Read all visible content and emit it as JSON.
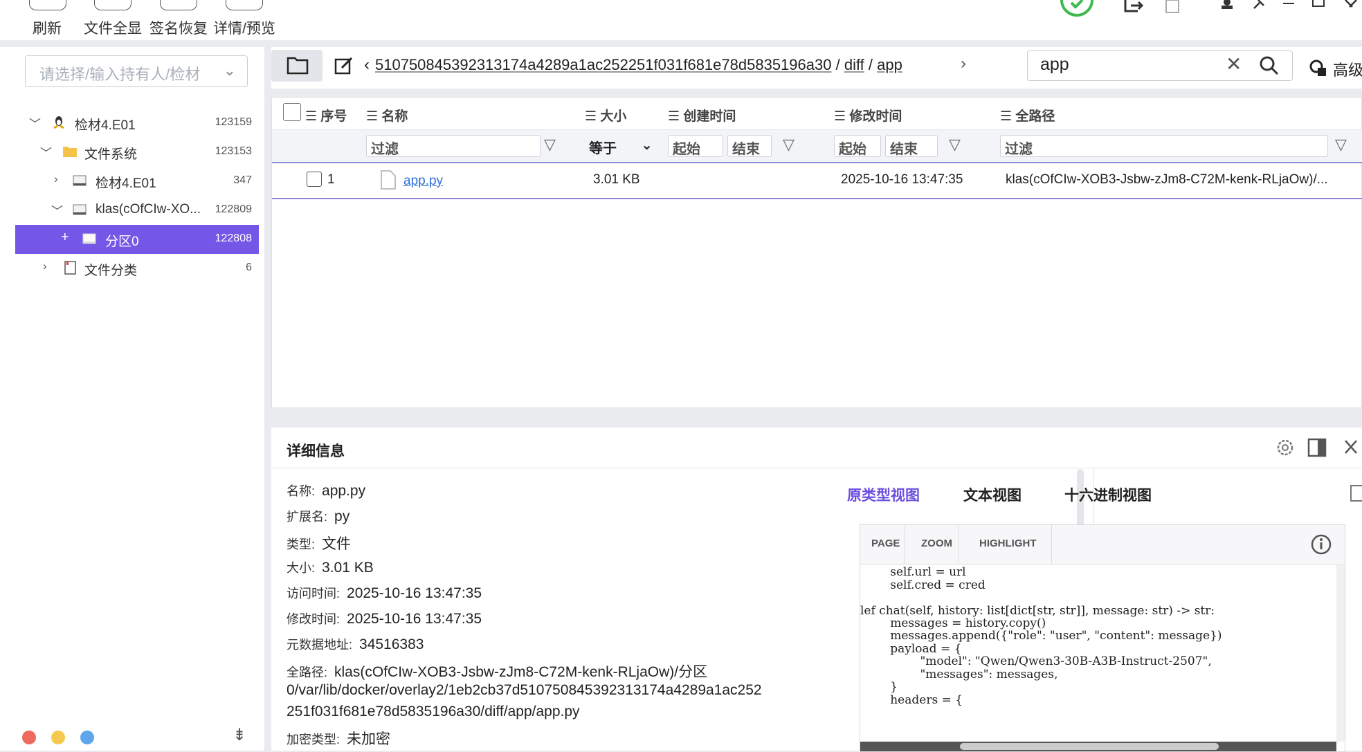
{
  "toolbar": {
    "refresh_label": "刷新",
    "show_all_label": "文件全显",
    "sig_recover_label": "签名恢复",
    "detail_preview_label": "详情/预览"
  },
  "sidebar": {
    "holder_placeholder": "请选择/输入持有人/检材",
    "tree": [
      {
        "label": "检材4.E01",
        "count": "123159"
      },
      {
        "label": "文件系统",
        "count": "123153"
      },
      {
        "label": "检材4.E01",
        "count": "347"
      },
      {
        "label": "klas(cOfCIw-XO...",
        "count": "122809"
      },
      {
        "label": "分区0",
        "count": "122808"
      },
      {
        "label": "文件分类",
        "count": "6"
      }
    ]
  },
  "breadcrumb": {
    "segments": [
      "510750845392313174a4289a1ac252251f031f681e78d5835196a30",
      "diff",
      "app"
    ],
    "separator": "/"
  },
  "search": {
    "value": "app",
    "advanced_label": "高级"
  },
  "table": {
    "columns": [
      "序号",
      "名称",
      "大小",
      "创建时间",
      "修改时间",
      "全路径"
    ],
    "filters": {
      "name_placeholder": "过滤",
      "size_op": "等于",
      "created_start": "起始",
      "created_end": "结束",
      "modified_start": "起始",
      "modified_end": "结束",
      "path_placeholder": "过滤"
    },
    "rows": [
      {
        "index": "1",
        "name": "app.py",
        "size": "3.01 KB",
        "created": "",
        "modified": "2025-10-16 13:47:35",
        "path": "klas(cOfCIw-XOB3-Jsbw-zJm8-C72M-kenk-RLjaOw)/..."
      }
    ]
  },
  "details": {
    "title": "详细信息",
    "fields": [
      {
        "key": "名称:",
        "value": "app.py"
      },
      {
        "key": "扩展名:",
        "value": "py"
      },
      {
        "key": "类型:",
        "value": "文件"
      },
      {
        "key": "大小:",
        "value": "3.01 KB"
      },
      {
        "key": "访问时间:",
        "value": "2025-10-16 13:47:35"
      },
      {
        "key": "修改时间:",
        "value": "2025-10-16 13:47:35"
      },
      {
        "key": "元数据地址:",
        "value": "34516383"
      }
    ],
    "fullpath_key": "全路径:",
    "fullpath_lines": [
      "klas(cOfCIw-XOB3-Jsbw-zJm8-C72M-kenk-RLjaOw)/分区",
      "0/var/lib/docker/overlay2/1eb2cb37d510750845392313174a4289a1ac252",
      "251f031f681e78d5835196a30/diff/app/app.py"
    ],
    "encrypt_key": "加密类型:",
    "encrypt_value": "未加密",
    "tabs": [
      "原类型视图",
      "文本视图",
      "十六进制视图"
    ],
    "viewer_buttons": [
      "PAGE",
      "ZOOM",
      "HIGHLIGHT"
    ],
    "code_lines": [
      "        self.url = url",
      "        self.cred = cred",
      "",
      "lef chat(self, history: list[dict[str, str]], message: str) -> str:",
      "        messages = history.copy()",
      "        messages.append({\"role\": \"user\", \"content\": message})",
      "        payload = {",
      "                \"model\": \"Qwen/Qwen3-30B-A3B-Instruct-2507\",",
      "                \"messages\": messages,",
      "        }",
      "        headers = {"
    ]
  },
  "colors": {
    "accent": "#7557e8",
    "link": "#2e6fd8",
    "tab_active": "#6b4fe0"
  }
}
